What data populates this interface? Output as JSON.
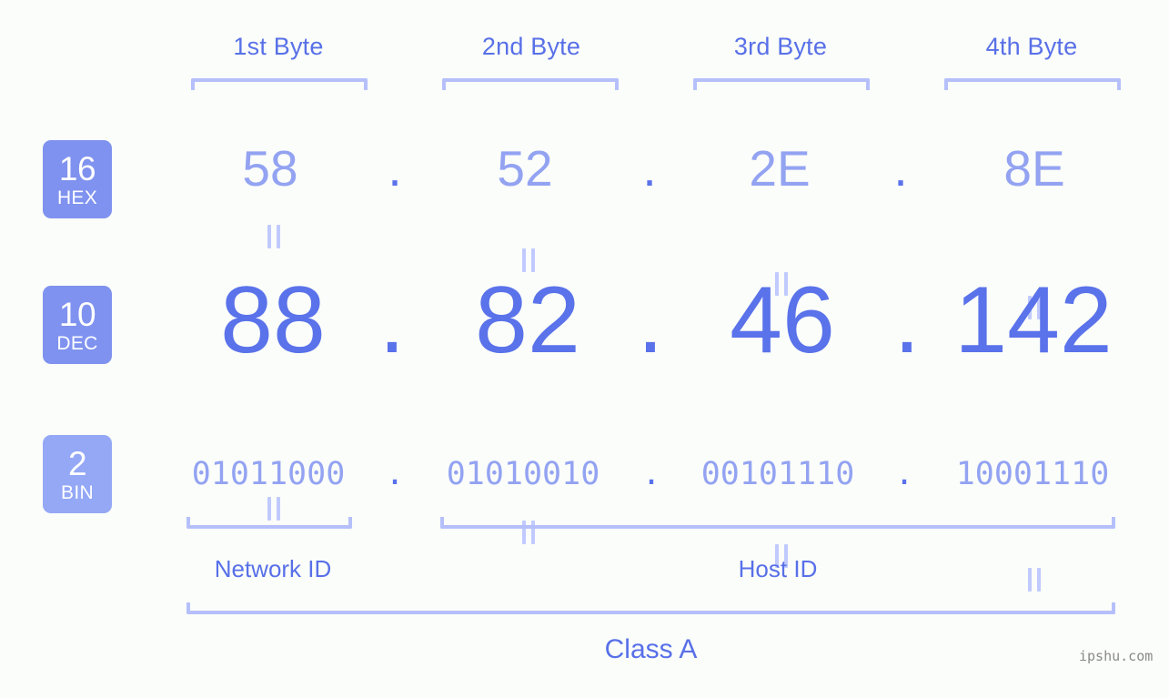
{
  "meta": {
    "background_color": "#fbfdfa",
    "accent_strong": "#5a72ea",
    "accent_mid": "#5870e8",
    "accent_light": "#93a3f2",
    "bracket_color": "#b5c0fb",
    "badge_color_hex": "#7f92ef",
    "badge_color_dec": "#7f92ef",
    "badge_color_bin": "#94a8f6"
  },
  "header": {
    "bytes": [
      {
        "label": "1st Byte"
      },
      {
        "label": "2nd Byte"
      },
      {
        "label": "3rd Byte"
      },
      {
        "label": "4th Byte"
      }
    ]
  },
  "badges": [
    {
      "number": "16",
      "name": "HEX"
    },
    {
      "number": "10",
      "name": "DEC"
    },
    {
      "number": "2",
      "name": "BIN"
    }
  ],
  "separator": {
    "dot": "."
  },
  "equals": {
    "symbol": "="
  },
  "rows": {
    "hex": {
      "base_number": "16",
      "base_name": "HEX",
      "values": [
        "58",
        "52",
        "2E",
        "8E"
      ]
    },
    "dec": {
      "base_number": "10",
      "base_name": "DEC",
      "values": [
        "88",
        "82",
        "46",
        "142"
      ]
    },
    "bin": {
      "base_number": "2",
      "base_name": "BIN",
      "values": [
        "01011000",
        "01010010",
        "00101110",
        "10001110"
      ]
    }
  },
  "sections": {
    "network_id": "Network ID",
    "host_id": "Host ID",
    "class": "Class A"
  },
  "watermark": {
    "text": "ipshu.com"
  }
}
